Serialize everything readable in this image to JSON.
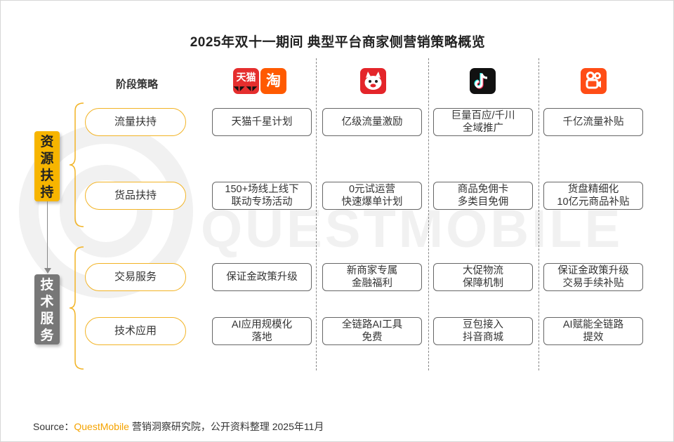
{
  "title": "2025年双十一期间 典型平台商家侧营销策略概览",
  "header_label": "阶段策略",
  "watermark": "QUESTMOBILE",
  "platforms": [
    {
      "name": "tmall-taobao",
      "icons": [
        "tmall-icon",
        "taobao-icon"
      ],
      "logo_text": [
        "天猫",
        "淘"
      ]
    },
    {
      "name": "jd",
      "icons": [
        "jd-icon"
      ]
    },
    {
      "name": "douyin",
      "icons": [
        "douyin-icon"
      ]
    },
    {
      "name": "kuaishou",
      "icons": [
        "kuaishou-icon"
      ]
    }
  ],
  "groups": [
    {
      "label_chars": [
        "资",
        "源",
        "扶",
        "持"
      ],
      "color": "#f7b500"
    },
    {
      "label_chars": [
        "技",
        "术",
        "服",
        "务"
      ],
      "color": "#777777"
    }
  ],
  "rows": [
    {
      "category": "流量扶持",
      "cells": [
        [
          "天猫千星计划"
        ],
        [
          "亿级流量激励"
        ],
        [
          "巨量百应/千川",
          "全域推广"
        ],
        [
          "千亿流量补贴"
        ]
      ]
    },
    {
      "category": "货品扶持",
      "cells": [
        [
          "150+场线上线下",
          "联动专场活动"
        ],
        [
          "0元试运营",
          "快速爆单计划"
        ],
        [
          "商品免佣卡",
          "多类目免佣"
        ],
        [
          "货盘精细化",
          "10亿元商品补贴"
        ]
      ]
    },
    {
      "category": "交易服务",
      "cells": [
        [
          "保证金政策升级"
        ],
        [
          "新商家专属",
          "金融福利"
        ],
        [
          "大促物流",
          "保障机制"
        ],
        [
          "保证金政策升级",
          "交易手续补贴"
        ]
      ]
    },
    {
      "category": "技术应用",
      "cells": [
        [
          "AI应用规模化",
          "落地"
        ],
        [
          "全链路AI工具",
          "免费"
        ],
        [
          "豆包接入",
          "抖音商城"
        ],
        [
          "AI赋能全链路",
          "提效"
        ]
      ]
    }
  ],
  "source": {
    "prefix": "Source：",
    "brand": "QuestMobile",
    "suffix": " 营销洞察研究院，公开资料整理 2025年11月"
  },
  "colors": {
    "accent": "#f7b500",
    "pill_border": "#f2b324",
    "tech_tag": "#777777",
    "brand_text": "#f5a300"
  }
}
